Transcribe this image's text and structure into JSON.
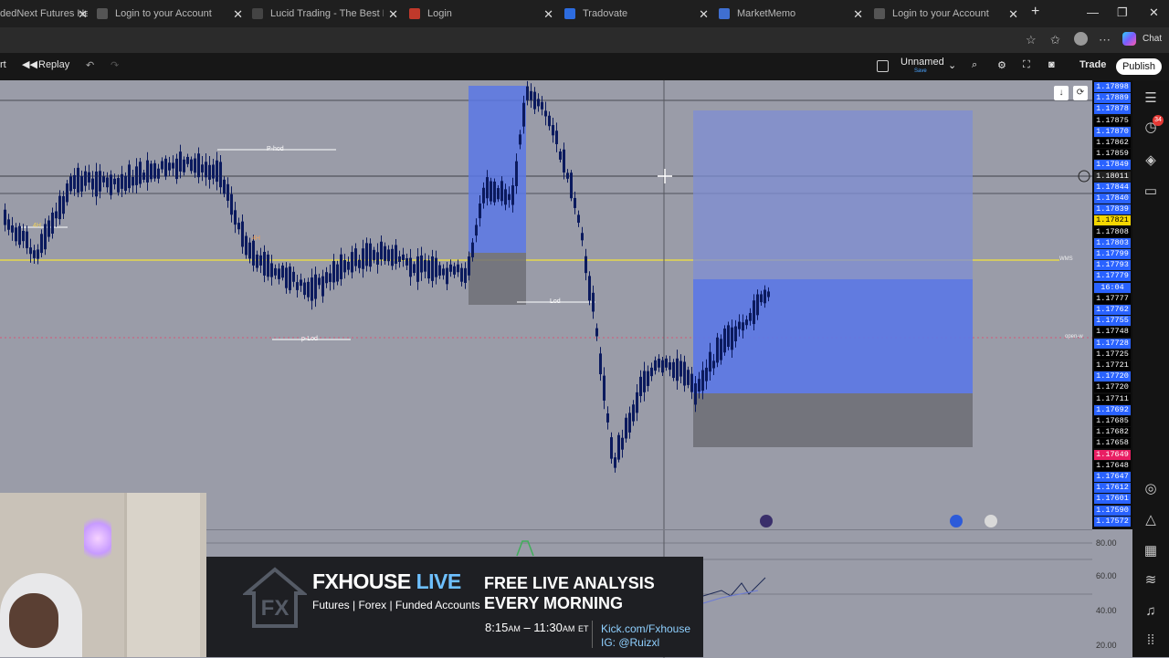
{
  "browser": {
    "tabs": [
      {
        "title": "dedNext Futures He",
        "color": "#4a90e2"
      },
      {
        "title": "Login to your Account",
        "color": "#888888"
      },
      {
        "title": "Lucid Trading - The Best Prop Fi",
        "color": "#444444"
      },
      {
        "title": "Login",
        "color": "#c0392b"
      },
      {
        "title": "Tradovate",
        "color": "#2d6cdf"
      },
      {
        "title": "MarketMemo",
        "color": "#3f6fd1"
      },
      {
        "title": "Login to your Account",
        "color": "#888888"
      }
    ],
    "chat_label": "Chat"
  },
  "toolbar": {
    "left_partial": "rt",
    "replay_label": "Replay",
    "layout_name": "Unnamed",
    "layout_sub": "Save",
    "trade_label": "Trade",
    "publish_label": "Publish"
  },
  "chart": {
    "labels": {
      "phod": "P-hod",
      "lod": "Lod",
      "plod": "p-Lod",
      "tf1": "4H",
      "tf2": "4H",
      "wms": "WMS",
      "open": "open-w"
    },
    "price_axis": [
      {
        "value": "1.17898",
        "bg": "#2962ff"
      },
      {
        "value": "1.17889",
        "bg": "#2962ff"
      },
      {
        "value": "1.17878",
        "bg": "#2962ff"
      },
      {
        "value": "1.17875",
        "bg": "#000000"
      },
      {
        "value": "1.17870",
        "bg": "#2962ff"
      },
      {
        "value": "1.17862",
        "bg": "#000000"
      },
      {
        "value": "1.17859",
        "bg": "#000000"
      },
      {
        "value": "1.17849",
        "bg": "#2962ff"
      },
      {
        "value": "1.18011",
        "bg": "#222222"
      },
      {
        "value": "1.17844",
        "bg": "#2962ff"
      },
      {
        "value": "1.17840",
        "bg": "#2962ff"
      },
      {
        "value": "1.17839",
        "bg": "#2962ff"
      },
      {
        "value": "1.17821",
        "bg": "#f5d700"
      },
      {
        "value": "1.17808",
        "bg": "#000000"
      },
      {
        "value": "1.17803",
        "bg": "#2962ff"
      },
      {
        "value": "1.17799",
        "bg": "#2962ff"
      },
      {
        "value": "1.17793",
        "bg": "#2962ff"
      },
      {
        "value": "1.17779",
        "bg": "#2962ff"
      },
      {
        "value": "16:04",
        "bg": "#2962ff"
      },
      {
        "value": "1.17777",
        "bg": "#000000"
      },
      {
        "value": "1.17762",
        "bg": "#2962ff"
      },
      {
        "value": "1.17755",
        "bg": "#2962ff"
      },
      {
        "value": "1.17748",
        "bg": "#000000"
      },
      {
        "value": "1.17728",
        "bg": "#2962ff"
      },
      {
        "value": "1.17725",
        "bg": "#000000"
      },
      {
        "value": "1.17721",
        "bg": "#000000"
      },
      {
        "value": "1.17720",
        "bg": "#2962ff"
      },
      {
        "value": "1.17720",
        "bg": "#000000"
      },
      {
        "value": "1.17711",
        "bg": "#000000"
      },
      {
        "value": "1.17692",
        "bg": "#2962ff"
      },
      {
        "value": "1.17685",
        "bg": "#000000"
      },
      {
        "value": "1.17682",
        "bg": "#000000"
      },
      {
        "value": "1.17658",
        "bg": "#000000"
      },
      {
        "value": "1.17649",
        "bg": "#e91e63"
      },
      {
        "value": "1.17648",
        "bg": "#000000"
      },
      {
        "value": "1.17647",
        "bg": "#2962ff"
      },
      {
        "value": "1.17612",
        "bg": "#2962ff"
      },
      {
        "value": "1.17601",
        "bg": "#2962ff"
      },
      {
        "value": "1.17590",
        "bg": "#2962ff"
      },
      {
        "value": "1.17572",
        "bg": "#2962ff"
      }
    ],
    "oscillator_axis": [
      "80.00",
      "60.00",
      "40.00",
      "20.00"
    ]
  },
  "banner": {
    "brand_a": "FXHOUSE",
    "brand_b": "LIVE",
    "tagline": "Futures | Forex | Funded Accounts",
    "headline_1": "FREE LIVE ANALYSIS",
    "headline_2": "EVERY MORNING",
    "time_a": "8:15",
    "am1": "AM",
    "time_b": "– 11:30",
    "am2": "AM",
    "tz": "ET",
    "link_1": "Kick.com/Fxhouse",
    "link_2": "IG: @Ruizxl"
  },
  "colors": {
    "candle": "#0b1a5e",
    "zone_blue": "#5b78e6",
    "zone_grey": "#6f7077",
    "yellow_line": "#e6d84a"
  }
}
